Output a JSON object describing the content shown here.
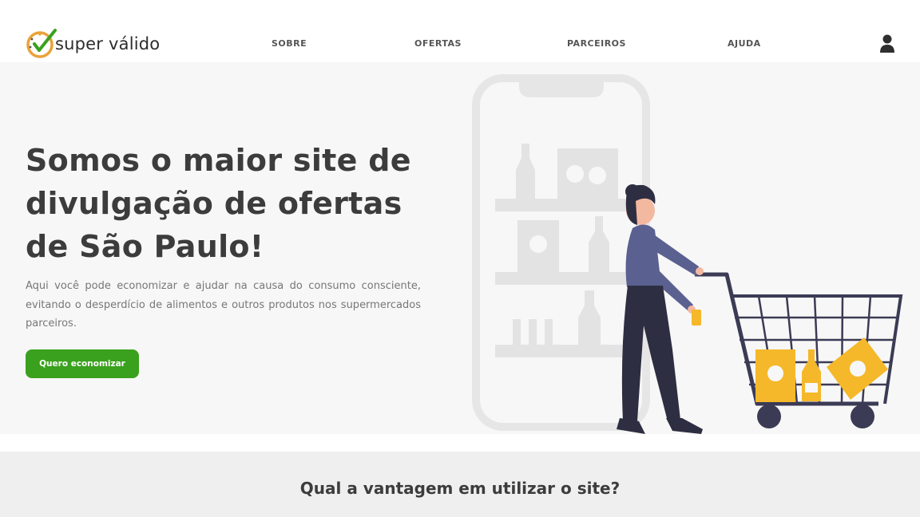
{
  "brand": {
    "name": "super válido",
    "accent": "#3aa11e",
    "clock_color": "#e8a33a"
  },
  "nav": {
    "sobre": "SOBRE",
    "ofertas": "OFERTAS",
    "parceiros": "PARCEIROS",
    "ajuda": "AJUDA"
  },
  "header": {
    "user_icon": "user-icon"
  },
  "hero": {
    "headline": "Somos o maior site de divulgação de ofertas de São Paulo!",
    "description": "Aqui você pode economizar e ajudar na causa do consumo consciente, evitando o desperdício de alimentos e outros produtos nos supermercados parceiros.",
    "cta_label": "Quero economizar",
    "illustration": "woman-with-shopping-cart-illustration"
  },
  "section": {
    "title": "Qual a vantagem em utilizar o site?"
  }
}
